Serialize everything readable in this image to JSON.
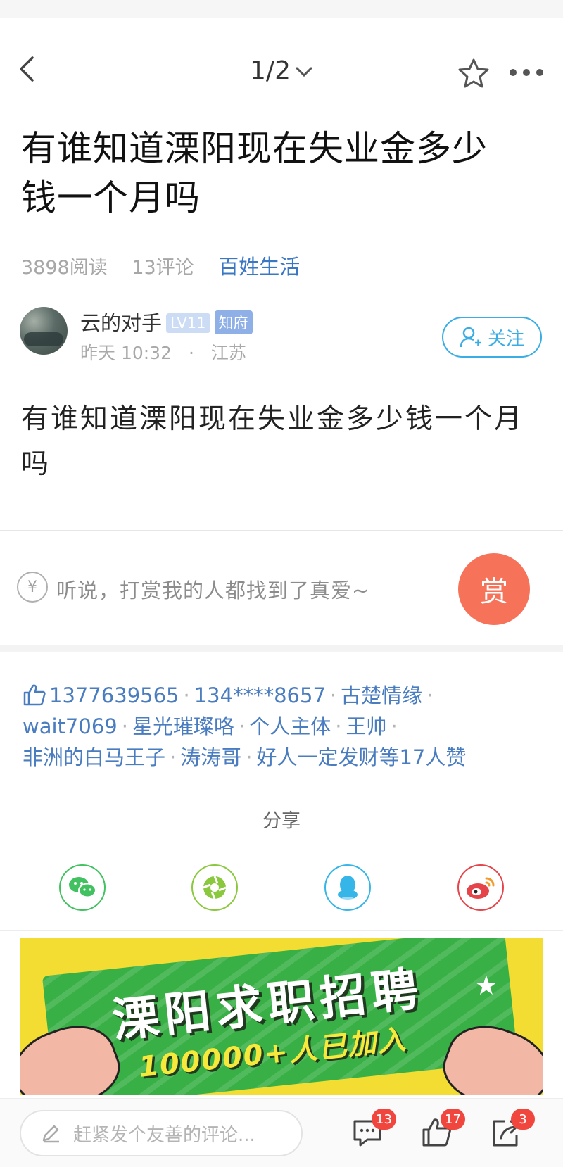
{
  "nav": {
    "page_indicator": "1/2",
    "icons": [
      "back-icon",
      "chevron-down-icon",
      "star-icon",
      "more-icon"
    ]
  },
  "post": {
    "title_line1": "有谁知道溧阳现在失业金多少",
    "title_line2": "钱一个月吗",
    "views": "3898阅读",
    "comments": "13评论",
    "category": "百姓生活",
    "body_line1": "有谁知道溧阳现在失业金多少钱一个月",
    "body_line2": "吗"
  },
  "author": {
    "name": "云的对手",
    "level_badge": "LV11",
    "title_badge": "知府",
    "time": "昨天 10:32",
    "separator": "·",
    "location": "江苏",
    "follow_label": "关注"
  },
  "reward": {
    "currency_symbol": "¥",
    "prompt": "听说，打赏我的人都找到了真爱~",
    "button_label": "赏"
  },
  "likes": {
    "users": [
      "1377639565",
      "134****8657",
      "古楚情缘",
      "wait7069",
      "星光璀璨咯",
      "个人主体",
      "王帅",
      "非洲的白马王子",
      "涛涛哥",
      "好人一定发财"
    ],
    "suffix": "等17人赞",
    "dot": "·"
  },
  "share": {
    "label": "分享",
    "items": [
      "wechat-icon",
      "moments-icon",
      "qq-icon",
      "weibo-icon"
    ]
  },
  "banner": {
    "headline": "溧阳求职招聘",
    "subline": "100000+人已加入"
  },
  "bottom_bar": {
    "comment_placeholder": "赶紧发个友善的评论...",
    "comment_count": "13",
    "like_count": "17",
    "share_count": "3"
  },
  "colors": {
    "accent_blue": "#3b78c4",
    "follow_blue": "#3aaee4",
    "reward_orange": "#f6735a",
    "badge_red": "#f0463e"
  }
}
